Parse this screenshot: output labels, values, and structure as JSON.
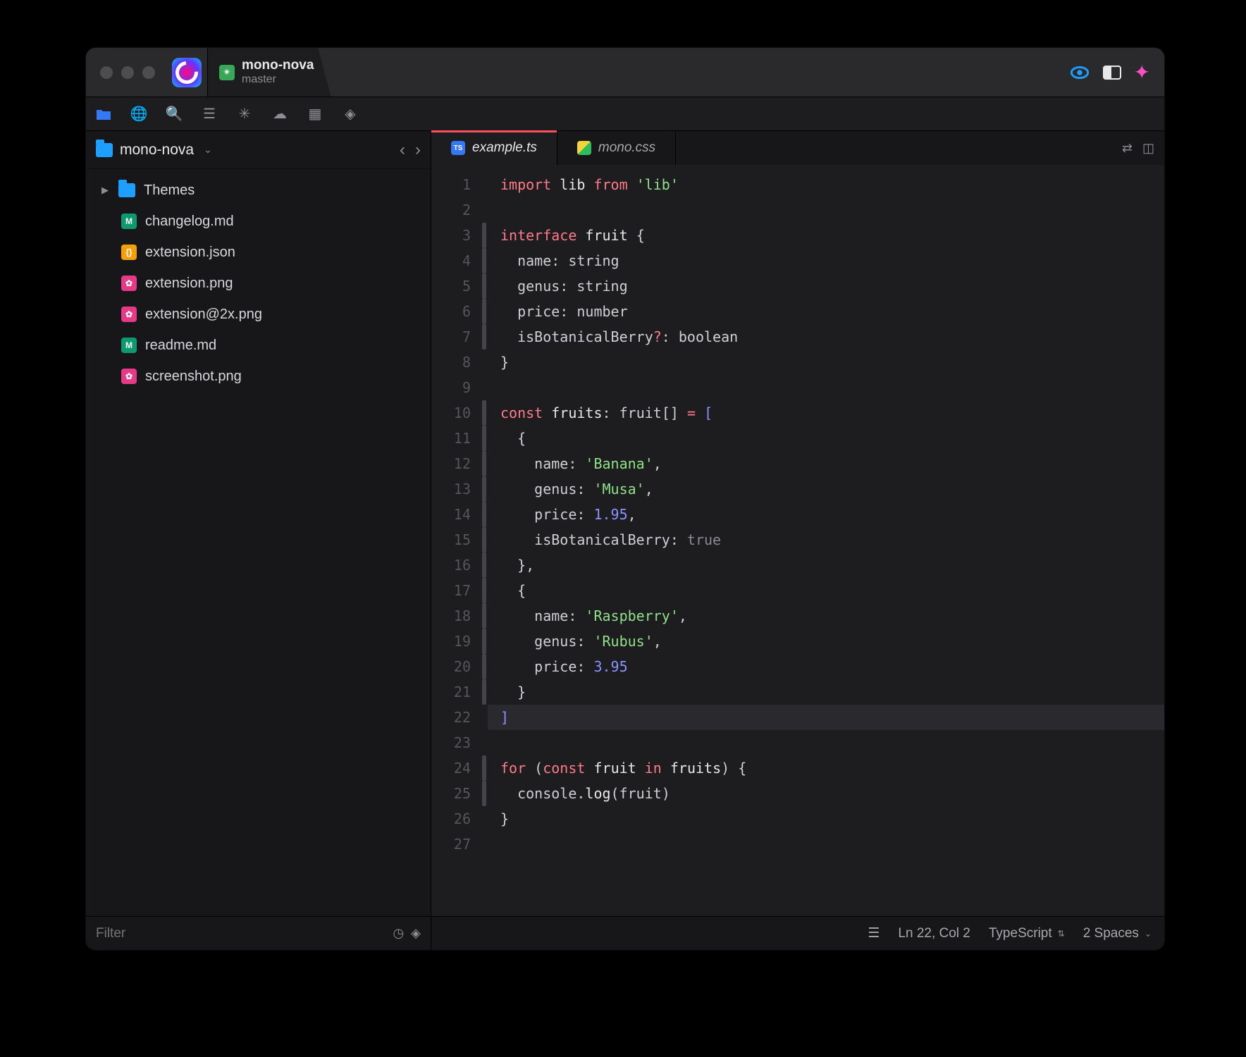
{
  "project": {
    "name": "mono-nova",
    "branch": "master"
  },
  "sidebar": {
    "root": "mono-nova",
    "filter_placeholder": "Filter",
    "items": [
      {
        "name": "Themes",
        "type": "folder",
        "expandable": true
      },
      {
        "name": "changelog.md",
        "type": "md"
      },
      {
        "name": "extension.json",
        "type": "json"
      },
      {
        "name": "extension.png",
        "type": "png"
      },
      {
        "name": "extension@2x.png",
        "type": "png"
      },
      {
        "name": "readme.md",
        "type": "md"
      },
      {
        "name": "screenshot.png",
        "type": "png"
      }
    ]
  },
  "tabs": [
    {
      "label": "example.ts",
      "icon": "ts",
      "active": true
    },
    {
      "label": "mono.css",
      "icon": "css",
      "active": false
    }
  ],
  "code": {
    "lines": [
      {
        "n": 1,
        "fold": false,
        "html": "<span class='kw'>import</span> <span class='id'>lib</span> <span class='kw'>from</span> <span class='st'>'lib'</span>"
      },
      {
        "n": 2,
        "fold": false,
        "html": ""
      },
      {
        "n": 3,
        "fold": true,
        "html": "<span class='kw'>interface</span> <span class='id'>fruit</span> <span class='pu'>{</span>"
      },
      {
        "n": 4,
        "fold": true,
        "html": "  name<span class='pu'>:</span> <span class='ty'>string</span>"
      },
      {
        "n": 5,
        "fold": true,
        "html": "  genus<span class='pu'>:</span> <span class='ty'>string</span>"
      },
      {
        "n": 6,
        "fold": true,
        "html": "  price<span class='pu'>:</span> <span class='ty'>number</span>"
      },
      {
        "n": 7,
        "fold": true,
        "html": "  isBotanicalBerry<span class='op'>?</span><span class='pu'>:</span> <span class='ty'>boolean</span>"
      },
      {
        "n": 8,
        "fold": false,
        "html": "<span class='pu'>}</span>"
      },
      {
        "n": 9,
        "fold": false,
        "html": ""
      },
      {
        "n": 10,
        "fold": true,
        "html": "<span class='kw'>const</span> <span class='id'>fruits</span><span class='pu'>:</span> <span class='ty'>fruit</span><span class='pu'>[]</span> <span class='op'>=</span> <span class='br'>[</span>"
      },
      {
        "n": 11,
        "fold": true,
        "html": "  <span class='pu'>{</span>"
      },
      {
        "n": 12,
        "fold": true,
        "html": "    name<span class='pu'>:</span> <span class='st'>'Banana'</span><span class='pu'>,</span>"
      },
      {
        "n": 13,
        "fold": true,
        "html": "    genus<span class='pu'>:</span> <span class='st'>'Musa'</span><span class='pu'>,</span>"
      },
      {
        "n": 14,
        "fold": true,
        "html": "    price<span class='pu'>:</span> <span class='nu'>1.95</span><span class='pu'>,</span>"
      },
      {
        "n": 15,
        "fold": true,
        "html": "    isBotanicalBerry<span class='pu'>:</span> <span class='bo'>true</span>"
      },
      {
        "n": 16,
        "fold": true,
        "html": "  <span class='pu'>},</span>"
      },
      {
        "n": 17,
        "fold": true,
        "html": "  <span class='pu'>{</span>"
      },
      {
        "n": 18,
        "fold": true,
        "html": "    name<span class='pu'>:</span> <span class='st'>'Raspberry'</span><span class='pu'>,</span>"
      },
      {
        "n": 19,
        "fold": true,
        "html": "    genus<span class='pu'>:</span> <span class='st'>'Rubus'</span><span class='pu'>,</span>"
      },
      {
        "n": 20,
        "fold": true,
        "html": "    price<span class='pu'>:</span> <span class='nu'>3.95</span>"
      },
      {
        "n": 21,
        "fold": true,
        "html": "  <span class='pu'>}</span>"
      },
      {
        "n": 22,
        "fold": false,
        "hl": true,
        "html": "<span class='br'>]</span>"
      },
      {
        "n": 23,
        "fold": false,
        "html": ""
      },
      {
        "n": 24,
        "fold": true,
        "html": "<span class='kw'>for</span> <span class='pu'>(</span><span class='kw'>const</span> <span class='id'>fruit</span> <span class='kw'>in</span> <span class='id'>fruits</span><span class='pu'>)</span> <span class='pu'>{</span>"
      },
      {
        "n": 25,
        "fold": true,
        "html": "  console<span class='pu'>.</span><span class='id'>log</span><span class='pu'>(</span>fruit<span class='pu'>)</span>"
      },
      {
        "n": 26,
        "fold": false,
        "html": "<span class='pu'>}</span>"
      },
      {
        "n": 27,
        "fold": false,
        "html": ""
      }
    ]
  },
  "status": {
    "position": "Ln 22, Col 2",
    "language": "TypeScript",
    "indent": "2 Spaces"
  }
}
